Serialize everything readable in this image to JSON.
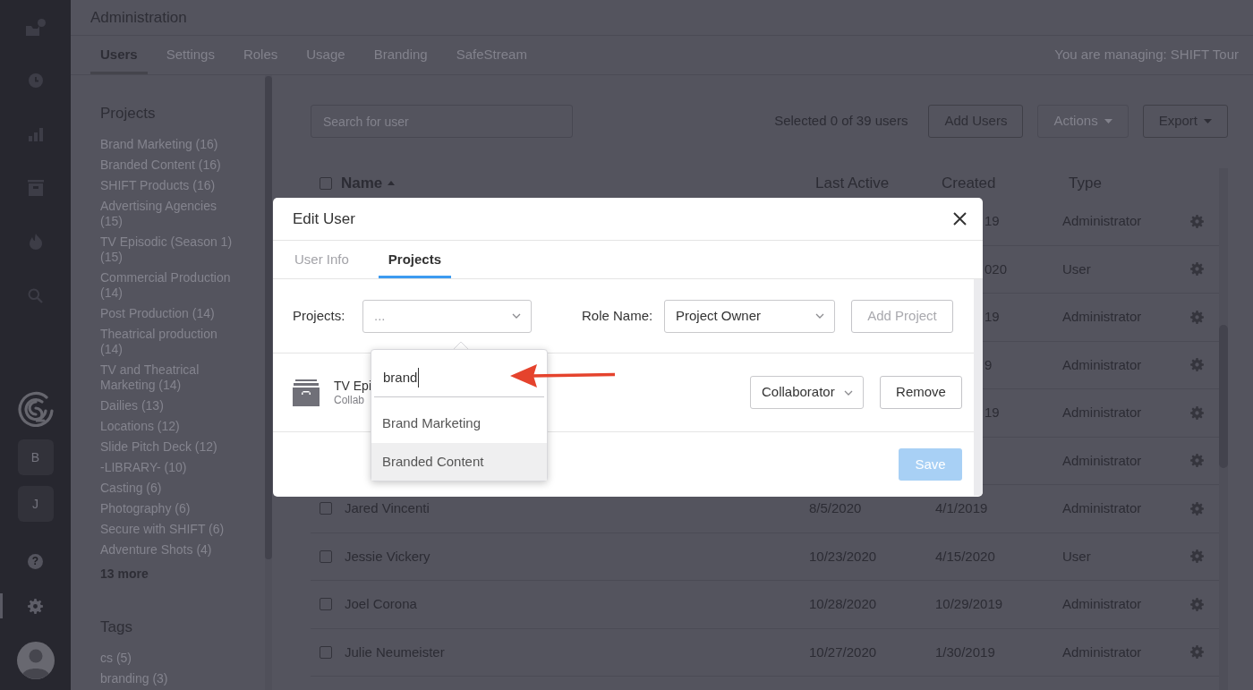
{
  "rail": {
    "nav": [
      {
        "selected": false
      },
      {
        "selected": false
      },
      {
        "selected": false
      },
      {
        "selected": false
      },
      {
        "selected": false
      },
      {
        "selected": false
      }
    ],
    "workspaces": [
      {
        "label": "B"
      },
      {
        "label": "J"
      }
    ],
    "help": {
      "label": "?"
    },
    "settings": {
      "selected": true
    }
  },
  "header": {
    "title": "Administration",
    "tabs": [
      {
        "label": "Users",
        "selected": true
      },
      {
        "label": "Settings",
        "selected": false
      },
      {
        "label": "Roles",
        "selected": false
      },
      {
        "label": "Usage",
        "selected": false
      },
      {
        "label": "Branding",
        "selected": false
      },
      {
        "label": "SafeStream",
        "selected": false
      }
    ],
    "managing": "You are managing: SHIFT Tour"
  },
  "filters": {
    "projects": {
      "title": "Projects",
      "items": [
        "Brand Marketing (16)",
        "Branded Content (16)",
        "SHIFT Products (16)",
        "Advertising Agencies (15)",
        "TV Episodic (Season 1) (15)",
        "Commercial Production (14)",
        "Post Production (14)",
        "Theatrical production (14)",
        "TV and Theatrical Marketing (14)",
        "Dailies (13)",
        "Locations (12)",
        "Slide Pitch Deck (12)",
        "-LIBRARY- (10)",
        "Casting (6)",
        "Photography (6)",
        "Secure with SHIFT (6)",
        "Adventure Shots (4)"
      ],
      "more": "13 more"
    },
    "tags": {
      "title": "Tags",
      "items": [
        "cs (5)",
        "branding (3)"
      ]
    }
  },
  "toolbar": {
    "search": {
      "placeholder": "Search for user"
    },
    "selection": "Selected 0 of 39 users",
    "buttons": [
      {
        "label": "Add Users",
        "disabled": false,
        "dropdown": false
      },
      {
        "label": "Actions",
        "disabled": true,
        "dropdown": true
      },
      {
        "label": "Export",
        "disabled": false,
        "dropdown": true
      }
    ]
  },
  "table": {
    "select_all": {
      "checked": false
    },
    "columns": [
      {
        "label": "Name",
        "sorted": true
      },
      {
        "label": "Last Active",
        "sorted": false
      },
      {
        "label": "Created",
        "sorted": false
      },
      {
        "label": "Type",
        "sorted": false
      }
    ],
    "rows": [
      {
        "kind": "partial",
        "created": "19",
        "type": "Administrator"
      },
      {
        "kind": "partial",
        "created": "020",
        "type": "User"
      },
      {
        "kind": "partial",
        "created": "19",
        "type": "Administrator"
      },
      {
        "kind": "partial",
        "created": "9",
        "type": "Administrator"
      },
      {
        "kind": "partial",
        "created": "19",
        "type": "Administrator"
      },
      {
        "kind": "partial",
        "type": "Administrator"
      },
      {
        "kind": "full",
        "checked": false,
        "name": "Jared Vincenti",
        "last_active": "8/5/2020",
        "created": "4/1/2019",
        "type": "Administrator"
      },
      {
        "kind": "full",
        "checked": false,
        "name": "Jessie Vickery",
        "last_active": "10/23/2020",
        "created": "4/15/2020",
        "type": "User"
      },
      {
        "kind": "full",
        "checked": false,
        "name": "Joel Corona",
        "last_active": "10/28/2020",
        "created": "10/29/2019",
        "type": "Administrator"
      },
      {
        "kind": "full",
        "checked": false,
        "name": "Julie Neumeister",
        "last_active": "10/27/2020",
        "created": "1/30/2019",
        "type": "Administrator"
      }
    ]
  },
  "modal": {
    "title": "Edit User",
    "tabs": [
      {
        "label": "User Info",
        "selected": false
      },
      {
        "label": "Projects",
        "selected": true
      }
    ],
    "add": {
      "projects_label": "Projects:",
      "projects_placeholder": "...",
      "role_label": "Role Name:",
      "role_value": "Project Owner",
      "button": {
        "label": "Add Project",
        "disabled": true
      }
    },
    "assigned": [
      {
        "name": "TV Epi",
        "role_caption": "Collab",
        "role": "Collaborator",
        "remove": "Remove"
      }
    ],
    "save": {
      "label": "Save",
      "disabled": true
    },
    "dropdown": {
      "query": "brand",
      "options": [
        {
          "label": "Brand Marketing",
          "selected": false
        },
        {
          "label": "Branded Content",
          "selected": true
        }
      ]
    }
  },
  "annotation": {
    "kind": "arrow"
  }
}
